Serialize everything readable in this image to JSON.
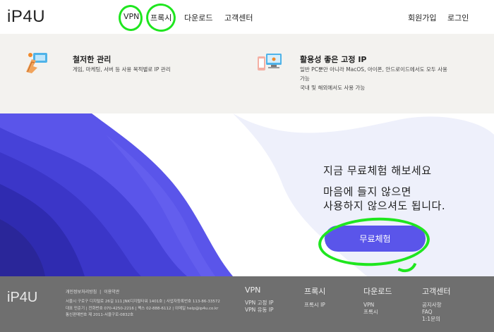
{
  "header": {
    "logo": "iP4U",
    "nav": {
      "vpn": "VPN",
      "proxy": "프록시",
      "download": "다운로드",
      "support": "고객센터"
    },
    "signup": "회원가입",
    "login": "로그인"
  },
  "features": [
    {
      "icon": "target-hand-icon",
      "title": "철저한 관리",
      "lines": [
        "게임, 마케팅, 서버 등 사용 목적별로 IP 관리"
      ]
    },
    {
      "icon": "devices-icon",
      "title": "활용성 좋은 고정 IP",
      "lines": [
        "일반 PC뿐만 아니라 MacOS, 아이폰, 안드로이드에서도 모두 사용",
        "가능",
        "국내 및 해외에서도 사용 가능"
      ]
    }
  ],
  "hero": {
    "line1": "지금 무료체험 해보세요",
    "line2": "마음에 들지 않으면",
    "line3": "사용하지 않으셔도 됩니다.",
    "button": "무료체험"
  },
  "colors": {
    "accent": "#5a55ea",
    "wave_dark": "#3b36c8",
    "wave_mid": "#5a55ea",
    "wave_light": "#eef0fb",
    "annotation": "#1fe61f",
    "footer_bg": "#6f6f6f"
  },
  "footer": {
    "logo": "iP4U",
    "privacy": "개인정보처리방침",
    "terms": "이용약관",
    "separator": "|",
    "info": [
      "서울시 구로구 디지털로 26길 111 JNK디지털타워 1401호 | 사업자등록번호 113-86-33572",
      "대표 민준기 | 전화번호 070-4250-2216 | 팩스 02-888-6112 | 이메일 help@ip4u.co.kr",
      "통신판매번호 제 2011-서울구로-0832호"
    ],
    "columns": [
      {
        "title": "VPN",
        "items": [
          "VPN 고정 IP",
          "VPN 유동 IP"
        ]
      },
      {
        "title": "프록시",
        "items": [
          "프록시 IP"
        ]
      },
      {
        "title": "다운로드",
        "items": [
          "VPN",
          "프록시"
        ]
      },
      {
        "title": "고객센터",
        "items": [
          "공지사항",
          "FAQ",
          "1:1문의"
        ]
      }
    ]
  }
}
